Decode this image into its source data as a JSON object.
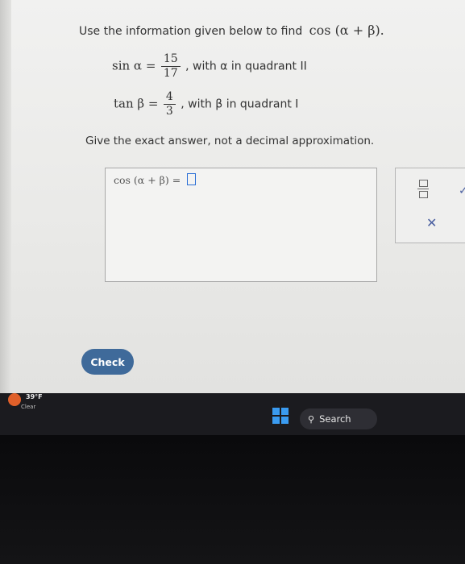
{
  "question": {
    "text": "Use the information given below to find",
    "expression": "cos (α + β)."
  },
  "givens": [
    {
      "lhs": "sin α =",
      "numerator": "15",
      "denominator": "17",
      "suffix": ", with α in quadrant II"
    },
    {
      "lhs": "tan β =",
      "numerator": "4",
      "denominator": "3",
      "suffix": ", with β in quadrant I"
    }
  ],
  "instruction": "Give the exact answer, not a decimal approximation.",
  "answer": {
    "expression": "cos (α + β) =",
    "value": ""
  },
  "tools": {
    "fraction_icon": "fraction-icon",
    "close_icon": "close-icon",
    "check_icon": "check-icon"
  },
  "check_button": {
    "label": "Check"
  },
  "taskbar": {
    "temperature": "39°F",
    "condition": "Clear",
    "search_label": "Search"
  },
  "colors": {
    "accent": "#3f6a9a",
    "input_focus": "#2b6fd6",
    "taskbar": "#1b1b1f"
  }
}
